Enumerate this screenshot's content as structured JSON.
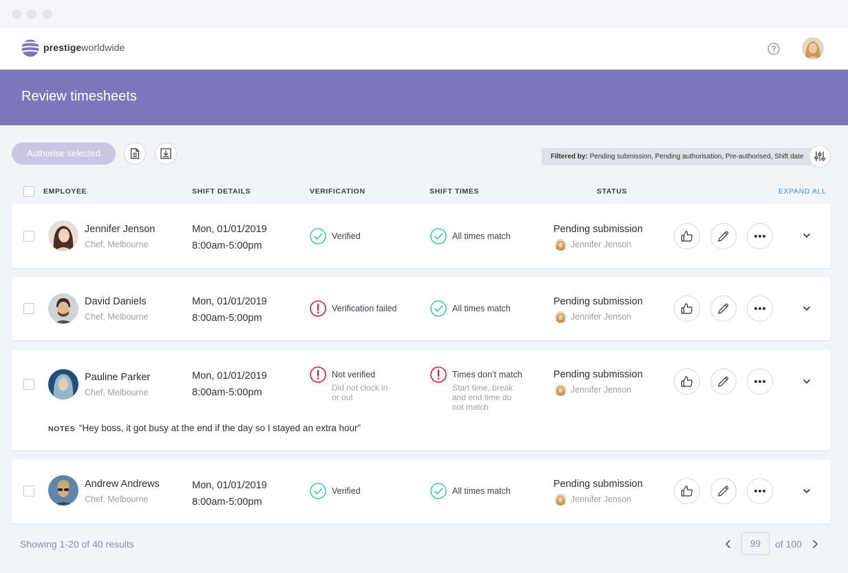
{
  "window": {
    "controls": [
      "close",
      "minimize",
      "maximize"
    ]
  },
  "nav": {
    "brand_bold": "prestige",
    "brand_light": "worldwide",
    "help_icon": "help-circle-icon",
    "avatar": "user-avatar"
  },
  "page": {
    "title": "Review timesheets"
  },
  "toolbar": {
    "authorise_label": "Authorise selected",
    "report_icon": "document-icon",
    "download_icon": "download-icon",
    "filter_prefix": "Filtered by:",
    "filter_value": "Pending submission, Pending authorisation, Pre-authorised, Shift date",
    "filter_icon": "sliders-icon"
  },
  "columns": {
    "employee": "EMPLOYEE",
    "shift_details": "SHIFT DETAILS",
    "verification": "VERIFICATION",
    "shift_times": "SHIFT TIMES",
    "status": "STATUS",
    "expand_all": "EXPAND ALL"
  },
  "rows": [
    {
      "name": "Jennifer Jenson",
      "role": "Chef, Melbourne",
      "date": "Mon, 01/01/2019",
      "time": "8:00am-5:00pm",
      "verification": {
        "state": "ok",
        "text": "Verified",
        "sub": ""
      },
      "times": {
        "state": "ok",
        "text": "All times match",
        "sub": ""
      },
      "status": "Pending submission",
      "status_by": "Jennifer Jenson"
    },
    {
      "name": "David Daniels",
      "role": "Chef, Melbourne",
      "date": "Mon, 01/01/2019",
      "time": "8:00am-5:00pm",
      "verification": {
        "state": "error",
        "text": "Verification failed",
        "sub": ""
      },
      "times": {
        "state": "ok",
        "text": "All times match",
        "sub": ""
      },
      "status": "Pending submission",
      "status_by": "Jennifer Jenson"
    },
    {
      "name": "Pauline Parker",
      "role": "Chef, Melbourne",
      "date": "Mon, 01/01/2019",
      "time": "8:00am-5:00pm",
      "verification": {
        "state": "error",
        "text": "Not verified",
        "sub": "Did not clock in or out"
      },
      "times": {
        "state": "error",
        "text": "Times don’t match",
        "sub": "Start time, break and end time do not match"
      },
      "status": "Pending submission",
      "status_by": "Jennifer Jenson",
      "notes_label": "NOTES",
      "notes": "“Hey boss, it got busy at the end if the day so I stayed an extra hour”"
    },
    {
      "name": "Andrew Andrews",
      "role": "Chef, Melbourne",
      "date": "Mon, 01/01/2019",
      "time": "8:00am-5:00pm",
      "verification": {
        "state": "ok",
        "text": "Verified",
        "sub": ""
      },
      "times": {
        "state": "ok",
        "text": "All times match",
        "sub": ""
      },
      "status": "Pending submission",
      "status_by": "Jennifer Jenson"
    }
  ],
  "footer": {
    "showing": "Showing 1-20 of 40 results",
    "page_value": "99",
    "page_total": "of 100"
  },
  "colors": {
    "banner": "#7b77ba",
    "ok": "#3cc6a3",
    "error": "#d81e3a",
    "link": "#4a90d9"
  }
}
